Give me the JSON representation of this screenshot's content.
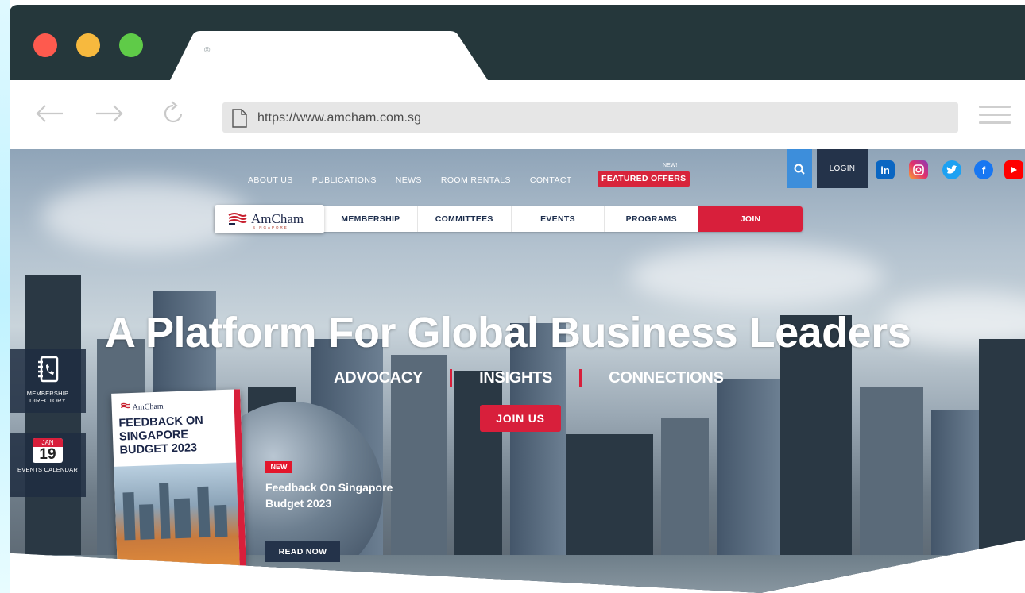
{
  "browser": {
    "url": "https://www.amcham.com.sg"
  },
  "site": {
    "top_nav": [
      "ABOUT US",
      "PUBLICATIONS",
      "NEWS",
      "ROOM RENTALS",
      "CONTACT"
    ],
    "featured_new": "NEW!",
    "featured_offers": "FEATURED OFFERS",
    "login": "LOGIN",
    "social_icons": [
      "linkedin-icon",
      "instagram-icon",
      "twitter-icon",
      "facebook-icon",
      "youtube-icon"
    ],
    "logo_text": "AmCham",
    "logo_sub": "SINGAPORE",
    "main_nav": [
      "MEMBERSHIP",
      "COMMITTEES",
      "EVENTS",
      "PROGRAMS"
    ],
    "join_label": "JOIN",
    "hero_title": "A Platform For Global Business Leaders",
    "hero_sub": [
      "ADVOCACY",
      "INSIGHTS",
      "CONNECTIONS"
    ],
    "join_us": "JOIN US",
    "directory_label": "MEMBERSHIP DIRECTORY",
    "calendar": {
      "month": "JAN",
      "day": "19",
      "label": "EVENTS CALENDAR"
    },
    "report": {
      "logo": "AmCham",
      "title": "FEEDBACK ON SINGAPORE BUDGET 2023"
    },
    "news": {
      "badge": "NEW",
      "title": "Feedback On Singapore Budget 2023",
      "cta": "READ NOW"
    },
    "colors": {
      "accent_red": "#d81f3b",
      "navy": "#24334a",
      "search_blue": "#3d8edb"
    }
  }
}
